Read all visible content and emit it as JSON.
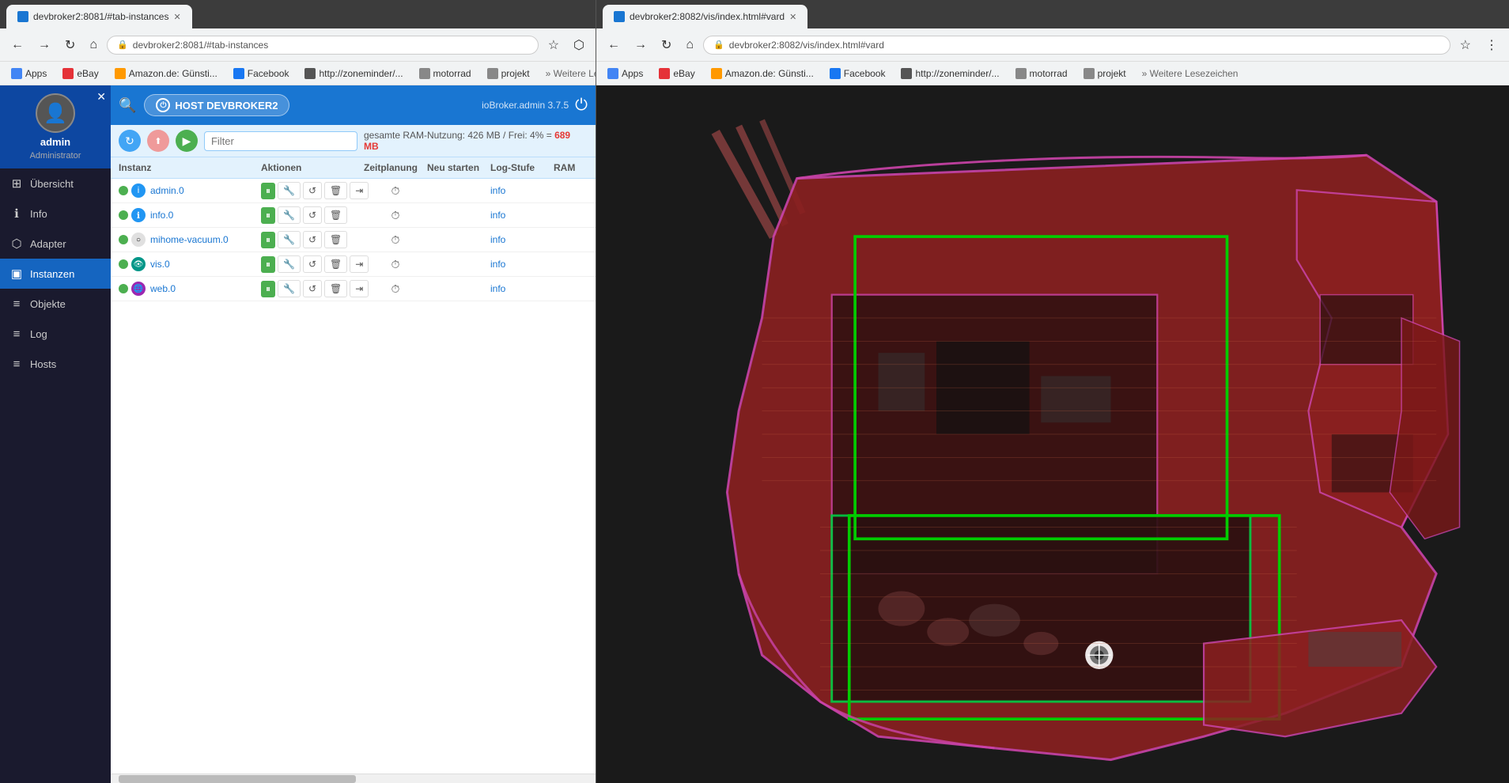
{
  "left_browser": {
    "tab_label": "devbroker2:8081/#tab-instances",
    "address": "devbroker2:8081/#tab-instances",
    "bookmarks": [
      "Apps",
      "eBay",
      "Amazon.de: Günsti...",
      "Facebook",
      "http://zoneminder/...",
      "motorrad",
      "projekt"
    ],
    "more_bookmarks": "Weitere Lesezeichen"
  },
  "right_browser": {
    "tab_label": "devbroker2:8082/vis/index.html#vard",
    "address": "devbroker2:8082/vis/index.html#vard",
    "bookmarks": [
      "Apps",
      "eBay",
      "Amazon.de: Günsti...",
      "Facebook",
      "http://zoneminder/...",
      "motorrad",
      "projekt"
    ],
    "more_bookmarks": "Weitere Lesezeichen"
  },
  "sidebar": {
    "username": "admin",
    "role": "Administrator",
    "items": [
      {
        "label": "Übersicht",
        "icon": "⊞"
      },
      {
        "label": "Info",
        "icon": "ℹ"
      },
      {
        "label": "Adapter",
        "icon": "⬡"
      },
      {
        "label": "Instanzen",
        "icon": "▣",
        "active": true
      },
      {
        "label": "Objekte",
        "icon": "≡"
      },
      {
        "label": "Log",
        "icon": "≡"
      },
      {
        "label": "Hosts",
        "icon": "≡"
      }
    ]
  },
  "header": {
    "host_label": "HOST DEVBROKER2",
    "version": "ioBroker.admin 3.7.5"
  },
  "filter_bar": {
    "filter_placeholder": "Filter",
    "ram_label": "gesamte RAM-Nutzung: 426 MB / Frei: 4% = ",
    "ram_value": "689 MB"
  },
  "table": {
    "columns": [
      "Instanz",
      "Aktionen",
      "Zeitplanung",
      "Neu starten",
      "Log-Stufe",
      "RAM"
    ],
    "rows": [
      {
        "name": "admin.0",
        "status": "green",
        "icon": "i",
        "icon_color": "blue",
        "loglevel": "info"
      },
      {
        "name": "info.0",
        "status": "green",
        "icon": "ℹ",
        "icon_color": "blue",
        "loglevel": "info"
      },
      {
        "name": "mihome-vacuum.0",
        "status": "grey",
        "icon": "○",
        "icon_color": "grey",
        "loglevel": "info"
      },
      {
        "name": "vis.0",
        "status": "green",
        "icon": "👁",
        "icon_color": "teal",
        "loglevel": "info"
      },
      {
        "name": "web.0",
        "status": "green",
        "icon": "🌐",
        "icon_color": "orange",
        "loglevel": "info"
      }
    ]
  },
  "actions": {
    "pause": "⏸",
    "wrench": "🔧",
    "refresh": "↺",
    "delete": "🗑",
    "link": "⇥",
    "clock": "⏱"
  }
}
